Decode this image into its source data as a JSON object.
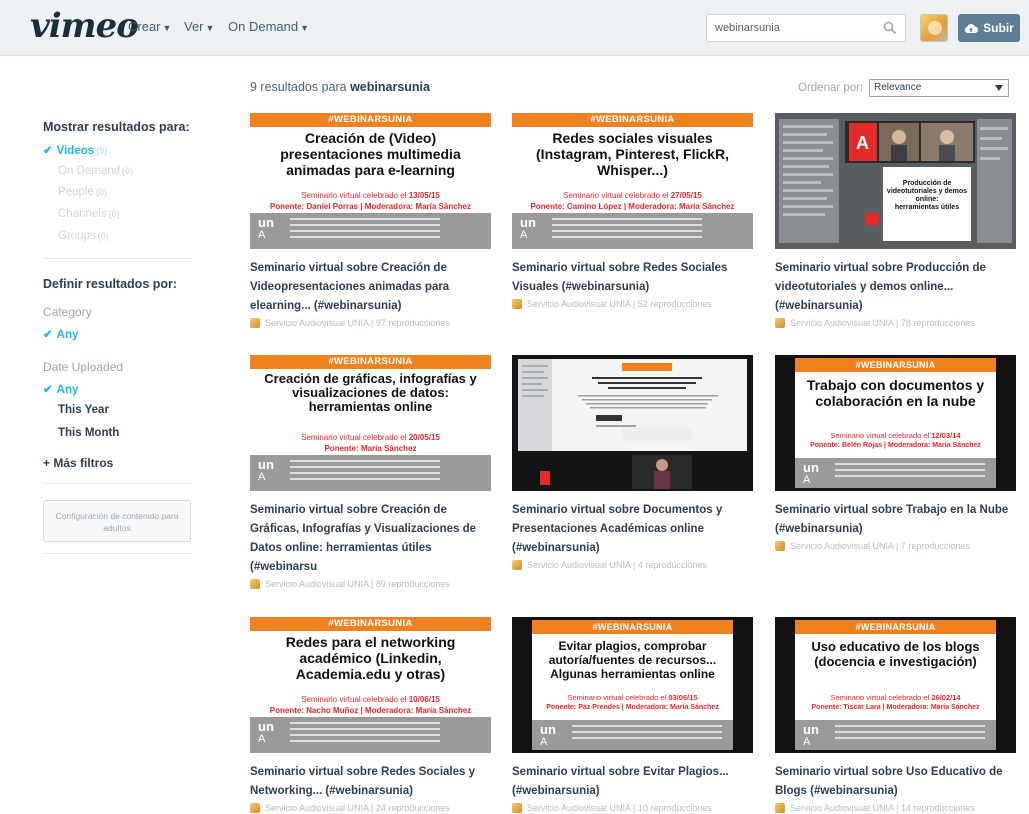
{
  "header": {
    "logo": "vimeo",
    "nav": [
      {
        "label": "Crear"
      },
      {
        "label": "Ver"
      },
      {
        "label": "On Demand"
      }
    ],
    "search_value": "webinarsunia",
    "upload_label": "Subir"
  },
  "results": {
    "count_prefix": "9 resultados para",
    "query": "webinarsunia",
    "sort_label": "Ordenar por:",
    "sort_value": "Relevance"
  },
  "sidebar": {
    "show_heading": "Mostrar resultados para:",
    "show_items": [
      {
        "label": "Videos",
        "count": "(9)"
      },
      {
        "label": "On Demand",
        "count": "(0)"
      },
      {
        "label": "People",
        "count": "(0)"
      },
      {
        "label": "Channels",
        "count": "(0)"
      },
      {
        "label": "Groups",
        "count": "(0)"
      }
    ],
    "refine_heading": "Definir resultados por:",
    "category_label": "Category",
    "category_any": "Any",
    "date_label": "Date Uploaded",
    "date_items": [
      "Any",
      "This Year",
      "This Month"
    ],
    "more_filters": "+ Más filtros",
    "adult_button": "Configuración de contenido para adultos"
  },
  "thumbs": {
    "banner": "#WEBINARSUNIA",
    "sem_prefix": "Seminario virtual celebrado el",
    "ponente_prefix": "Ponente:",
    "moderadora": "Moderadora: María Sánchez",
    "un": "un",
    "ia": "A",
    "t1_title": "Creación de (Video) presentaciones multimedia animadas para e-learning",
    "t1_date": "13/05/15",
    "t1_ponente": "Daniel Porras",
    "t2_title": "Redes sociales visuales (Instagram, Pinterest, FlickR, Whisper...)",
    "t2_date": "27/05/15",
    "t2_ponente": "Camino López",
    "t4_title": "Creación de gráficas, infografías y visualizaciones de datos: herramientas online",
    "t4_date": "20/05/15",
    "t4_ponente": "María Sánchez",
    "t6_title": "Trabajo con documentos y colaboración en la nube",
    "t6_date": "12/03/14",
    "t6_ponente": "Belén Rojas",
    "t7_title": "Redes para el networking académico (Linkedin, Academia.edu y otras)",
    "t7_date": "10/06/15",
    "t7_ponente": "Nacho Muñoz",
    "t8_title": "Evitar plagios, comprobar autoría/fuentes de recursos... Algunas herramientas online",
    "t8_date": "03/06/15",
    "t8_ponente": "Paz Prendes",
    "t9_title": "Uso educativo de los blogs (docencia e investigación)",
    "t9_date": "26/02/14",
    "t9_ponente": "Tiscar Lara"
  },
  "cards": [
    {
      "title": "Seminario virtual sobre Creación de Videopresentaciones animadas para elearning... (#webinarsunia)",
      "meta": "Servicio Audiovisual UNIA | 97 reproducciones"
    },
    {
      "title": "Seminario virtual sobre Redes Sociales Visuales (#webinarsunia)",
      "meta": "Servicio Audiovisual UNIA | 52 reproducciones"
    },
    {
      "title": "Seminario virtual sobre Producción de videotutoriales y demos online... (#webinarsunia)",
      "meta": "Servicio Audiovisual UNIA | 78 reproducciones"
    },
    {
      "title": "Seminario virtual sobre Creación de Gráficas, Infografías y Visualizaciones de Datos online: herramientas útiles (#webinarsu",
      "meta": "Servicio Audiovisual UNIA | 89 reproducciones"
    },
    {
      "title": "Seminario virtual sobre Documentos y Presentaciones Académicas online (#webinarsunia)",
      "meta": "Servicio Audiovisual UNIA | 4 reproducciones"
    },
    {
      "title": "Seminario virtual sobre Trabajo en la Nube (#webinarsunia)",
      "meta": "Servicio Audiovisual UNIA | 7 reproducciones"
    },
    {
      "title": "Seminario virtual sobre Redes Sociales y Networking... (#webinarsunia)",
      "meta": "Servicio Audiovisual UNIA | 24 reproducciones"
    },
    {
      "title": "Seminario virtual sobre Evitar Plagios... (#webinarsunia)",
      "meta": "Servicio Audiovisual UNIA | 10 reproducciones"
    },
    {
      "title": "Seminario virtual sobre Uso Educativo de Blogs (#webinarsunia)",
      "meta": "Servicio Audiovisual UNIA | 14 reproducciones"
    }
  ],
  "colors": {
    "accent": "#1ab7ea",
    "banner_orange": "#f0811f",
    "seminar_red": "#e8252b",
    "upload_button": "#5f7d95"
  },
  "icons": {
    "search": "magnifier-icon",
    "upload": "cloud-upload-icon",
    "check": "checkmark-icon"
  }
}
